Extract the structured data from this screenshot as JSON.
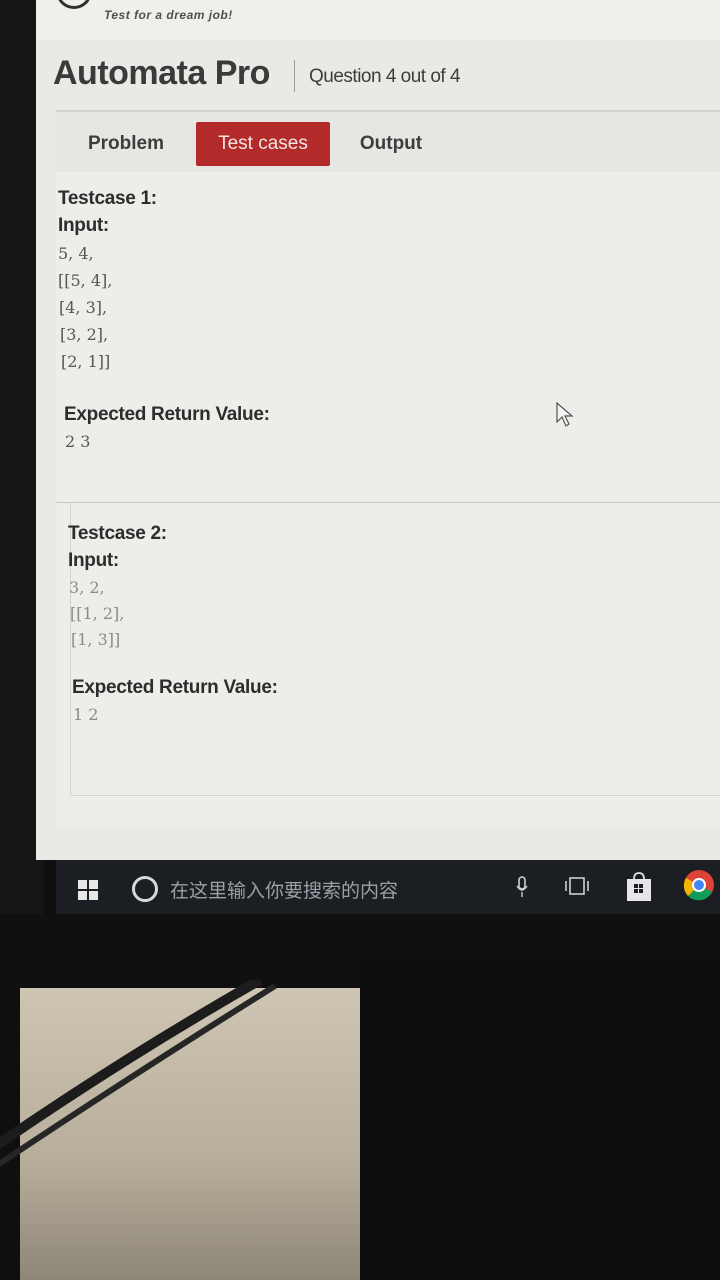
{
  "brand": {
    "tagline": "Test for a dream job!"
  },
  "header": {
    "title": "Automata Pro",
    "question": "Question 4 out of 4"
  },
  "tabs": [
    {
      "label": "Problem",
      "active": false
    },
    {
      "label": "Test cases",
      "active": true
    },
    {
      "label": "Output",
      "active": false
    }
  ],
  "testcases": [
    {
      "title": "Testcase 1:",
      "input_label": "Input:",
      "input_lines": [
        "5, 4,",
        "[[5, 4],",
        "[4, 3],",
        "[3, 2],",
        "[2, 1]]"
      ],
      "expected_label": "Expected Return Value:",
      "expected_value": "2 3"
    },
    {
      "title": "Testcase 2:",
      "input_label": "Input:",
      "input_lines": [
        "3, 2,",
        "[[1, 2],",
        "[1, 3]]"
      ],
      "expected_label": "Expected Return Value:",
      "expected_value": "1 2"
    }
  ],
  "taskbar": {
    "search_placeholder": "在这里输入你要搜索的内容",
    "icons": [
      "windows-start-icon",
      "cortana-icon",
      "microphone-icon",
      "task-view-icon",
      "store-icon",
      "chrome-icon"
    ]
  },
  "colors": {
    "active_tab": "#b32a2a",
    "taskbar": "#1b1e22",
    "page": "#e9e9e6"
  }
}
